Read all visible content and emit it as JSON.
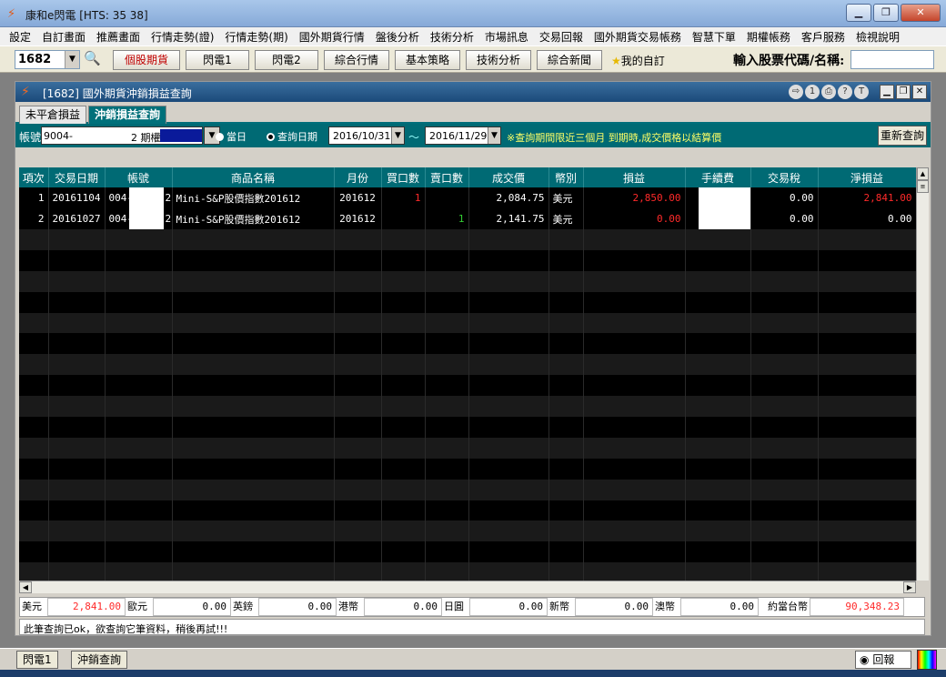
{
  "app": {
    "title": "康和e閃電 [HTS: 35 38]"
  },
  "menu": [
    "設定",
    "自訂畫面",
    "推薦畫面",
    "行情走勢(證)",
    "行情走勢(期)",
    "國外期貨行情",
    "盤後分析",
    "技術分析",
    "市場訊息",
    "交易回報",
    "國外期貨交易帳務",
    "智慧下單",
    "期權帳務",
    "客戶服務",
    "檢視說明"
  ],
  "toolbar": {
    "code": "1682",
    "buttons": [
      "個股期貨",
      "閃電1",
      "閃電2",
      "綜合行情",
      "基本策略",
      "技術分析",
      "綜合新聞"
    ],
    "favorites": "我的自訂",
    "stock_label": "輸入股票代碼/名稱:"
  },
  "window": {
    "title": "[1682] 國外期貨沖銷損益查詢"
  },
  "tabs": [
    "未平倉損益",
    "沖銷損益查詢"
  ],
  "filter": {
    "account_label": "帳號",
    "account_prefix": "9004-",
    "account_suffix": "2 期權",
    "radio_today": "當日",
    "radio_query": "查詢日期",
    "date_from": "2016/10/31",
    "tilde": "～",
    "date_to": "2016/11/29",
    "note": "※查詢期間限近三個月 到期時,成交價格以結算價",
    "requery": "重新查詢"
  },
  "table": {
    "headers": [
      "項次",
      "交易日期",
      "帳號",
      "商品名稱",
      "月份",
      "買口數",
      "賣口數",
      "成交價",
      "幣別",
      "損益",
      "手續費",
      "交易稅",
      "淨損益"
    ],
    "rows": [
      {
        "no": "1",
        "date": "20161104",
        "acct_a": "004-",
        "acct_b": "2",
        "product": "Mini-S&P股價指數201612",
        "month": "201612",
        "buy": "1",
        "sell": "",
        "price": "2,084.75",
        "currency": "美元",
        "pnl": "2,850.00",
        "tax": "0.00",
        "net": "2,841.00"
      },
      {
        "no": "2",
        "date": "20161027",
        "acct_a": "004-",
        "acct_b": "2",
        "product": "Mini-S&P股價指數201612",
        "month": "201612",
        "buy": "",
        "sell": "1",
        "price": "2,141.75",
        "currency": "美元",
        "pnl": "0.00",
        "tax": "0.00",
        "net": "0.00"
      }
    ]
  },
  "footer": {
    "currencies": [
      {
        "name": "美元",
        "value": "2,841.00"
      },
      {
        "name": "歐元",
        "value": "0.00"
      },
      {
        "name": "英鎊",
        "value": "0.00"
      },
      {
        "name": "港幣",
        "value": "0.00"
      },
      {
        "name": "日圓",
        "value": "0.00"
      },
      {
        "name": "新幣",
        "value": "0.00"
      },
      {
        "name": "澳幣",
        "value": "0.00"
      }
    ],
    "twd_label": "約當台幣",
    "twd_value": "90,348.23"
  },
  "status": "此筆查詢已ok，欲查詢它筆資料，稍後再試!!!",
  "bottom": {
    "tabs": [
      "閃電1",
      "沖銷查詢"
    ],
    "report": "回報"
  },
  "colors": {
    "accent": "#006a74",
    "loss": "#ff2a2a",
    "gain": "#33cc33"
  }
}
